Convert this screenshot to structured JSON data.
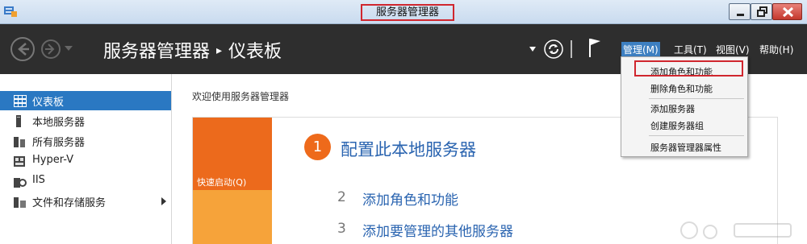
{
  "window": {
    "title": "服务器管理器"
  },
  "header": {
    "app_name": "服务器管理器",
    "page": "仪表板",
    "menus": {
      "manage": "管理(M)",
      "tools": "工具(T)",
      "view": "视图(V)",
      "help": "帮助(H)"
    }
  },
  "manage_menu": {
    "items": [
      "添加角色和功能",
      "删除角色和功能",
      "添加服务器",
      "创建服务器组",
      "服务器管理器属性"
    ]
  },
  "sidebar": {
    "items": [
      {
        "label": "仪表板",
        "icon": "dashboard-grid-icon",
        "active": true
      },
      {
        "label": "本地服务器",
        "icon": "server-icon"
      },
      {
        "label": "所有服务器",
        "icon": "servers-icon"
      },
      {
        "label": "Hyper-V",
        "icon": "hyperv-icon"
      },
      {
        "label": "IIS",
        "icon": "iis-icon"
      },
      {
        "label": "文件和存储服务",
        "icon": "file-storage-icon"
      }
    ]
  },
  "main": {
    "welcome": "欢迎使用服务器管理器",
    "quick_start": "快速启动(Q)",
    "steps": [
      {
        "num": "1",
        "label": "配置此本地服务器"
      },
      {
        "num": "2",
        "label": "添加角色和功能"
      },
      {
        "num": "3",
        "label": "添加要管理的其他服务器"
      }
    ]
  },
  "colors": {
    "header_bg": "#2e2e2e",
    "accent_blue": "#2a78c2",
    "orange": "#ec6a1c",
    "light_orange": "#f6a33a",
    "highlight_red": "#d0262e"
  }
}
